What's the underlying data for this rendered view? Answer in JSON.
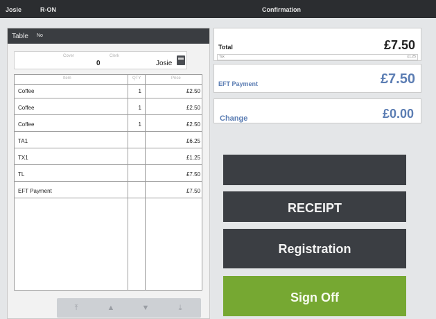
{
  "topbar": {
    "user": "Josie",
    "mode": "R-ON",
    "title": "Confirmation"
  },
  "left_panel": {
    "header_title": "Table",
    "header_sub": "No",
    "info": {
      "cover_label": "Cover",
      "cover_value": "0",
      "clerk_label": "Clerk",
      "clerk_value": "Josie"
    },
    "table": {
      "columns": [
        "Item",
        "QTY",
        "Price"
      ],
      "rows": [
        {
          "item": "Coffee",
          "qty": "1",
          "price": "£2.50"
        },
        {
          "item": "Coffee",
          "qty": "1",
          "price": "£2.50"
        },
        {
          "item": "Coffee",
          "qty": "1",
          "price": "£2.50"
        },
        {
          "item": "TA1",
          "qty": "",
          "price": "£6.25"
        },
        {
          "item": "TX1",
          "qty": "",
          "price": "£1.25"
        },
        {
          "item": "TL",
          "qty": "",
          "price": "£7.50"
        },
        {
          "item": "EFT Payment",
          "qty": "",
          "price": "£7.50"
        }
      ]
    },
    "nav_arrows": [
      "⤒",
      "▲",
      "▼",
      "⤓"
    ]
  },
  "right_panel": {
    "total": {
      "label": "Total",
      "value": "£7.50",
      "sub_label": "Tax",
      "sub_value": "£1.25"
    },
    "eft": {
      "label": "EFT Payment",
      "value": "£7.50"
    },
    "change": {
      "label": "Change",
      "value": "£0.00"
    },
    "buttons": {
      "blank": "",
      "receipt": "RECEIPT",
      "registration": "Registration",
      "sign_off": "Sign Off"
    }
  },
  "colors": {
    "accent_blue": "#5b7db3",
    "dark_button": "#3b3e43",
    "green_button": "#76a832",
    "topbar": "#2b2d30"
  }
}
